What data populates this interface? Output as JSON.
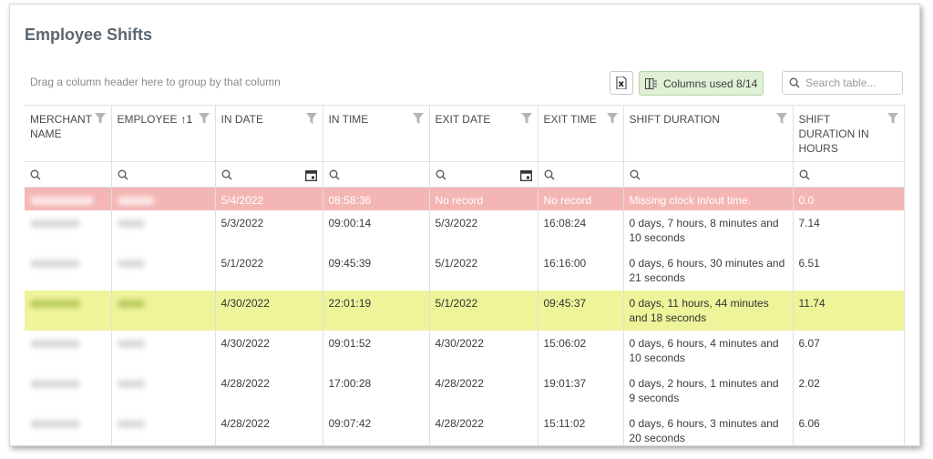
{
  "title": "Employee Shifts",
  "group_hint": "Drag a column header here to group by that column",
  "toolbar": {
    "excel_icon": "excel-export-icon",
    "columns_label": "Columns used 8/14",
    "search_placeholder": "Search table..."
  },
  "columns": [
    {
      "label": "MERCHANT NAME"
    },
    {
      "label": "EMPLOYEE",
      "sort": "↑1"
    },
    {
      "label": "IN DATE"
    },
    {
      "label": "IN TIME"
    },
    {
      "label": "EXIT DATE"
    },
    {
      "label": "EXIT TIME"
    },
    {
      "label": "SHIFT DURATION"
    },
    {
      "label": "SHIFT DURATION IN HOURS"
    }
  ],
  "rows": [
    {
      "in_date": "5/4/2022",
      "in_time": "08:58:36",
      "exit_date": "No record",
      "exit_time": "No record",
      "duration": "Missing clock in/out time.",
      "hours": "0.0"
    },
    {
      "in_date": "5/3/2022",
      "in_time": "09:00:14",
      "exit_date": "5/3/2022",
      "exit_time": "16:08:24",
      "duration": "0 days, 7 hours, 8 minutes and 10 seconds",
      "hours": "7.14"
    },
    {
      "in_date": "5/1/2022",
      "in_time": "09:45:39",
      "exit_date": "5/1/2022",
      "exit_time": "16:16:00",
      "duration": "0 days, 6 hours, 30 minutes and 21 seconds",
      "hours": "6.51"
    },
    {
      "in_date": "4/30/2022",
      "in_time": "22:01:19",
      "exit_date": "5/1/2022",
      "exit_time": "09:45:37",
      "duration": "0 days, 11 hours, 44 minutes and 18 seconds",
      "hours": "11.74"
    },
    {
      "in_date": "4/30/2022",
      "in_time": "09:01:52",
      "exit_date": "4/30/2022",
      "exit_time": "15:06:02",
      "duration": "0 days, 6 hours, 4 minutes and 10 seconds",
      "hours": "6.07"
    },
    {
      "in_date": "4/28/2022",
      "in_time": "17:00:28",
      "exit_date": "4/28/2022",
      "exit_time": "19:01:37",
      "duration": "0 days, 2 hours, 1 minutes and 9 seconds",
      "hours": "2.02"
    },
    {
      "in_date": "4/28/2022",
      "in_time": "09:07:42",
      "exit_date": "4/28/2022",
      "exit_time": "15:11:02",
      "duration": "0 days, 6 hours, 3 minutes and 20 seconds",
      "hours": "6.06"
    }
  ],
  "colors": {
    "missing_row": "#f4b6b5",
    "overnight_row": "#eef49a",
    "columns_button": "#dff0d5"
  }
}
